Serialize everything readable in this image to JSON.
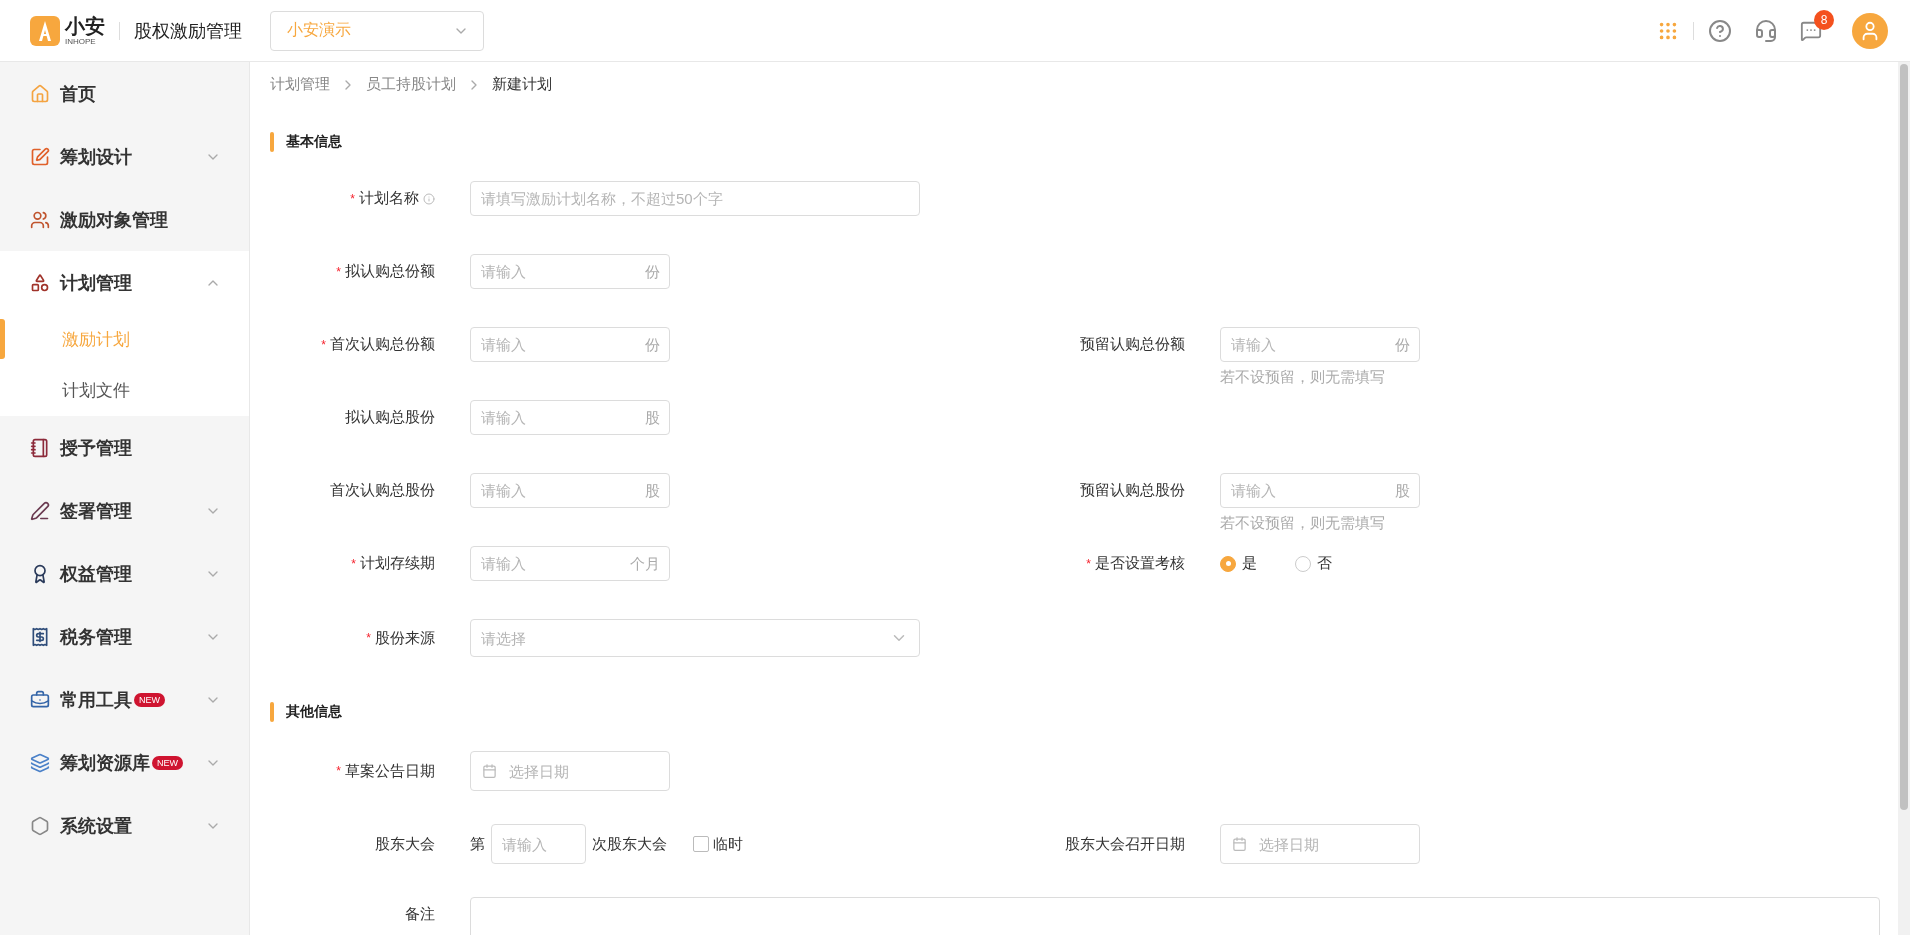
{
  "header": {
    "logo_text": "小安",
    "logo_sub": "INHOPE",
    "app_title": "股权激励管理",
    "company_select": "小安演示",
    "notification_count": "8"
  },
  "sidebar": {
    "items": [
      {
        "label": "首页",
        "kind": "link",
        "selected": false
      },
      {
        "label": "筹划设计",
        "kind": "group",
        "expanded": false,
        "selected": false
      },
      {
        "label": "激励对象管理",
        "kind": "link",
        "selected": false
      },
      {
        "label": "计划管理",
        "kind": "group",
        "expanded": true,
        "selected": false,
        "children": [
          {
            "label": "激励计划",
            "selected": true
          },
          {
            "label": "计划文件",
            "selected": false
          }
        ]
      },
      {
        "label": "授予管理",
        "kind": "link",
        "selected": false
      },
      {
        "label": "签署管理",
        "kind": "group",
        "expanded": false,
        "selected": false
      },
      {
        "label": "权益管理",
        "kind": "group",
        "expanded": false,
        "selected": false
      },
      {
        "label": "税务管理",
        "kind": "group",
        "expanded": false,
        "selected": false
      },
      {
        "label": "常用工具",
        "kind": "group",
        "expanded": false,
        "selected": false,
        "badge": "NEW"
      },
      {
        "label": "筹划资源库",
        "kind": "group",
        "expanded": false,
        "selected": false,
        "badge": "NEW"
      },
      {
        "label": "系统设置",
        "kind": "group",
        "expanded": false,
        "selected": false
      }
    ]
  },
  "breadcrumb": [
    "计划管理",
    "员工持股计划",
    "新建计划"
  ],
  "sections": [
    {
      "title": "基本信息",
      "rows": [
        {
          "left": {
            "kind": "text",
            "label": "计划名称",
            "required": "*",
            "info": true,
            "placeholder": "请填写激励计划名称，不超过50个字"
          }
        },
        {
          "left": {
            "kind": "number",
            "label": "拟认购总份额",
            "required": "*",
            "placeholder": "请输入",
            "unit": "份"
          }
        },
        {
          "left": {
            "kind": "number",
            "label": "首次认购总份额",
            "required": "*",
            "placeholder": "请输入",
            "unit": "份"
          },
          "right": {
            "kind": "number",
            "label": "预留认购总份额",
            "placeholder": "请输入",
            "unit": "份",
            "hint": "若不设预留，则无需填写"
          }
        },
        {
          "left": {
            "kind": "number",
            "label": "拟认购总股份",
            "placeholder": "请输入",
            "unit": "股"
          }
        },
        {
          "left": {
            "kind": "number",
            "label": "首次认购总股份",
            "placeholder": "请输入",
            "unit": "股"
          },
          "right": {
            "kind": "number",
            "label": "预留认购总股份",
            "placeholder": "请输入",
            "unit": "股",
            "hint": "若不设预留，则无需填写"
          }
        },
        {
          "left": {
            "kind": "number",
            "label": "计划存续期",
            "required": "*",
            "placeholder": "请输入",
            "unit": "个月"
          },
          "right": {
            "kind": "radio",
            "label": "是否设置考核",
            "required": "*",
            "options": [
              {
                "label": "是",
                "selected": true
              },
              {
                "label": "否",
                "selected": false
              }
            ]
          }
        },
        {
          "left": {
            "kind": "select",
            "label": "股份来源",
            "required": "*",
            "placeholder": "请选择"
          }
        }
      ]
    },
    {
      "title": "其他信息",
      "rows": [
        {
          "left": {
            "kind": "date",
            "label": "草案公告日期",
            "required": "*",
            "placeholder": "选择日期"
          }
        },
        {
          "left": {
            "kind": "meeting",
            "label": "股东大会",
            "prefix": "第",
            "placeholder": "请输入",
            "suffix": "次股东大会",
            "checkbox": {
              "label": "临时",
              "checked": false
            }
          },
          "right": {
            "kind": "date",
            "label": "股东大会召开日期",
            "placeholder": "选择日期"
          }
        },
        {
          "left": {
            "kind": "textarea",
            "label": "备注"
          }
        }
      ]
    }
  ]
}
